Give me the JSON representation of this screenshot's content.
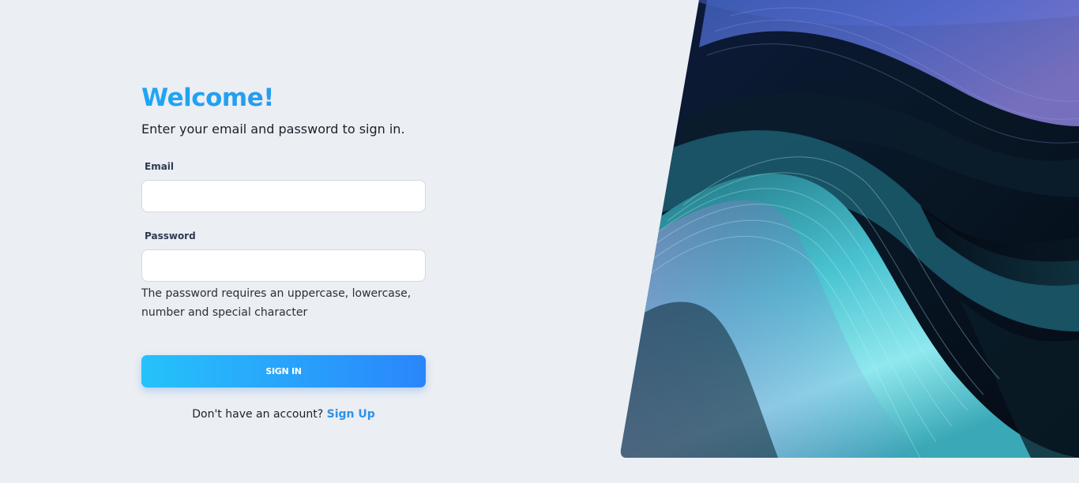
{
  "login": {
    "title": "Welcome!",
    "subtitle": "Enter your email and password to sign in.",
    "email_label": "Email",
    "email_value": "",
    "password_label": "Password",
    "password_value": "",
    "password_hint": "The password requires an uppercase, lowercase, number and special character",
    "signin_label": "SIGN IN",
    "signup_prompt": "Don't have an account?",
    "signup_link": "Sign Up"
  },
  "colors": {
    "background": "#ebeef3",
    "accent": "#1fa6f4",
    "button_start": "#26c2fb",
    "button_end": "#2a86fb",
    "link": "#2e92ea"
  },
  "art_panel": {
    "description_icon": "abstract-wave-image"
  }
}
